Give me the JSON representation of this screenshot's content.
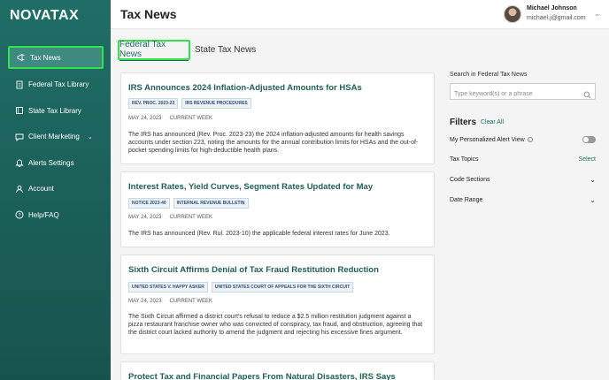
{
  "app": {
    "logo": "NOVATAX"
  },
  "header": {
    "title": "Tax News",
    "user_name": "Michael Johnson",
    "user_email": "michael.j@gmail.com"
  },
  "sidebar": {
    "items": [
      {
        "label": "Tax News",
        "icon": "megaphone-icon"
      },
      {
        "label": "Federal Tax Library",
        "icon": "document-icon"
      },
      {
        "label": "State Tax Library",
        "icon": "library-icon"
      },
      {
        "label": "Client Marketing",
        "icon": "chat-icon"
      },
      {
        "label": "Alerts Settings",
        "icon": "bell-icon"
      },
      {
        "label": "Account",
        "icon": "user-icon"
      },
      {
        "label": "Help/FAQ",
        "icon": "help-icon"
      }
    ]
  },
  "tabs": {
    "federal": "Federal Tax News",
    "state": "State Tax News"
  },
  "articles": [
    {
      "title": "IRS Announces 2024 Inflation-Adjusted Amounts for HSAs",
      "tags": [
        "REV. PROC. 2023-23",
        "IRS REVENUE PROCEDURES"
      ],
      "date": "MAY 24, 2023",
      "period": "CURRENT WEEK",
      "body": "The IRS has announced (Rev. Proc. 2023-23) the 2024 inflation-adjusted amounts for health savings accounts under section 223, noting the amounts for the annual contribution limits for HSAs and the out-of-pocket spending limits for high-deductible health plans."
    },
    {
      "title": "Interest Rates, Yield Curves, Segment Rates Updated for May",
      "tags": [
        "NOTICE 2023-40",
        "INTERNAL REVENUE BULLETIN"
      ],
      "date": "MAY 24, 2023",
      "period": "CURRENT WEEK",
      "body": "The IRS has announced (Rev. Rul. 2023-10) the applicable federal interest rates for June 2023."
    },
    {
      "title": "Sixth Circuit Affirms Denial of Tax Fraud Restitution Reduction",
      "tags": [
        "UNITED STATES V. HAPPY ASKER",
        "UNITED STATES COURT OF APPEALS FOR THE SIXTH CIRCUIT"
      ],
      "date": "MAY 24, 2023",
      "period": "CURRENT WEEK",
      "body": "The Sixth Circuit affirmed a district court's refusal to reduce a $2.5 million restitution judgment against a pizza restaurant franchise owner who was convicted of conspiracy, tax fraud, and obstruction, agreeing that the district court lacked authority to amend the judgment and rejecting his excessive fines argument."
    },
    {
      "title": "Protect Tax and Financial Papers From Natural Disasters, IRS Says"
    }
  ],
  "search": {
    "label": "Search in Federal Tax News",
    "placeholder": "Type keyword(s) or a phrase"
  },
  "filters": {
    "title": "Filters",
    "clear_all": "Clear All",
    "alert_view": "My Personalized Alert View",
    "tax_topics": "Tax Topics",
    "select": "Select",
    "code_sections": "Code Sections",
    "date_range": "Date Range"
  },
  "colors": {
    "brand": "#1f6e66",
    "highlight": "#35e04a"
  }
}
